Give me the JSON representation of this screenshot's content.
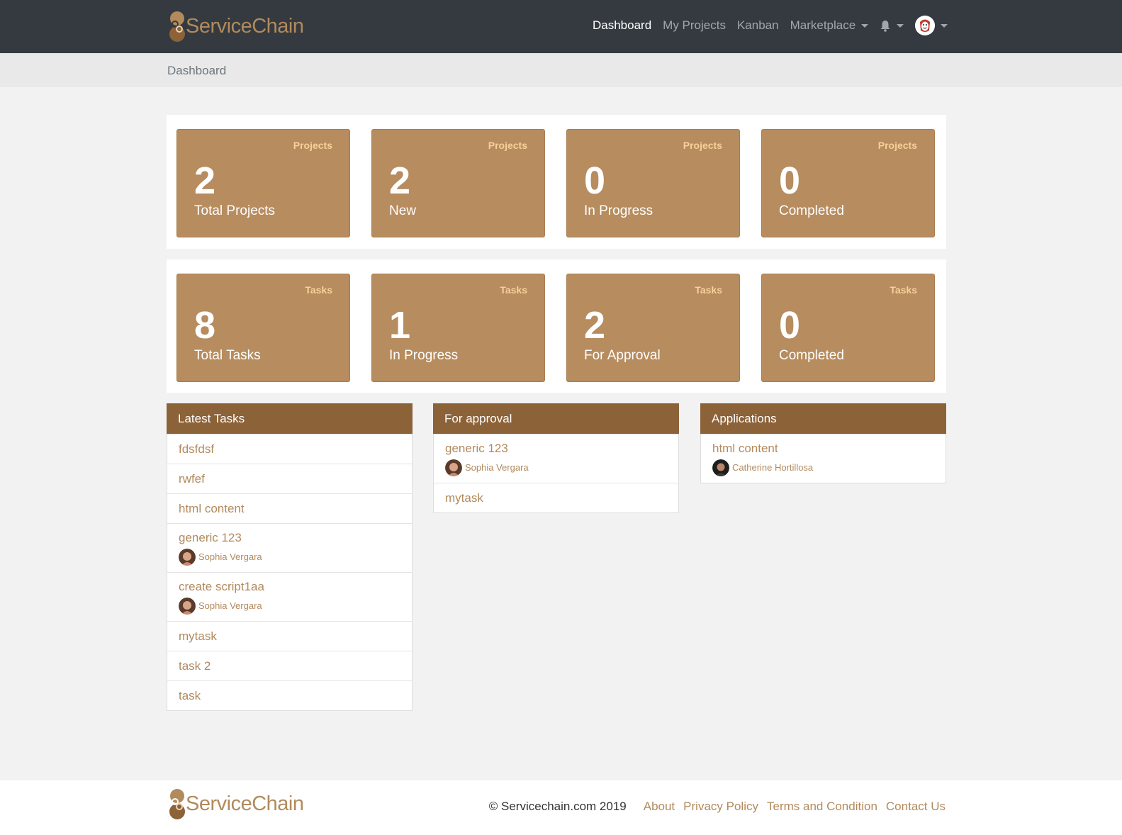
{
  "brand": {
    "name": "ServiceChain"
  },
  "nav": {
    "dashboard": "Dashboard",
    "my_projects": "My Projects",
    "kanban": "Kanban",
    "marketplace": "Marketplace"
  },
  "breadcrumb": "Dashboard",
  "project_stats": [
    {
      "tag": "Projects",
      "value": "2",
      "label": "Total Projects"
    },
    {
      "tag": "Projects",
      "value": "2",
      "label": "New"
    },
    {
      "tag": "Projects",
      "value": "0",
      "label": "In Progress"
    },
    {
      "tag": "Projects",
      "value": "0",
      "label": "Completed"
    }
  ],
  "task_stats": [
    {
      "tag": "Tasks",
      "value": "8",
      "label": "Total Tasks"
    },
    {
      "tag": "Tasks",
      "value": "1",
      "label": "In Progress"
    },
    {
      "tag": "Tasks",
      "value": "2",
      "label": "For Approval"
    },
    {
      "tag": "Tasks",
      "value": "0",
      "label": "Completed"
    }
  ],
  "latest_tasks": {
    "title": "Latest Tasks",
    "items": [
      {
        "title": "fdsfdsf"
      },
      {
        "title": "rwfef"
      },
      {
        "title": "html content"
      },
      {
        "title": "generic 123",
        "user": "Sophia Vergara"
      },
      {
        "title": "create script1aa",
        "user": "Sophia Vergara"
      },
      {
        "title": "mytask"
      },
      {
        "title": "task 2"
      },
      {
        "title": "task"
      }
    ]
  },
  "for_approval": {
    "title": "For approval",
    "items": [
      {
        "title": "generic 123",
        "user": "Sophia Vergara"
      },
      {
        "title": "mytask"
      }
    ]
  },
  "applications": {
    "title": "Applications",
    "items": [
      {
        "title": "html content",
        "user": "Catherine Hortillosa"
      }
    ]
  },
  "footer": {
    "copyright": "© Servicechain.com 2019",
    "links": [
      "About",
      "Privacy Policy",
      "Terms and Condition",
      "Contact Us"
    ]
  },
  "colors": {
    "accent": "#b28a5c",
    "card": "#b78c5e",
    "panel_header": "#8c6239",
    "navbar": "#343a40"
  }
}
